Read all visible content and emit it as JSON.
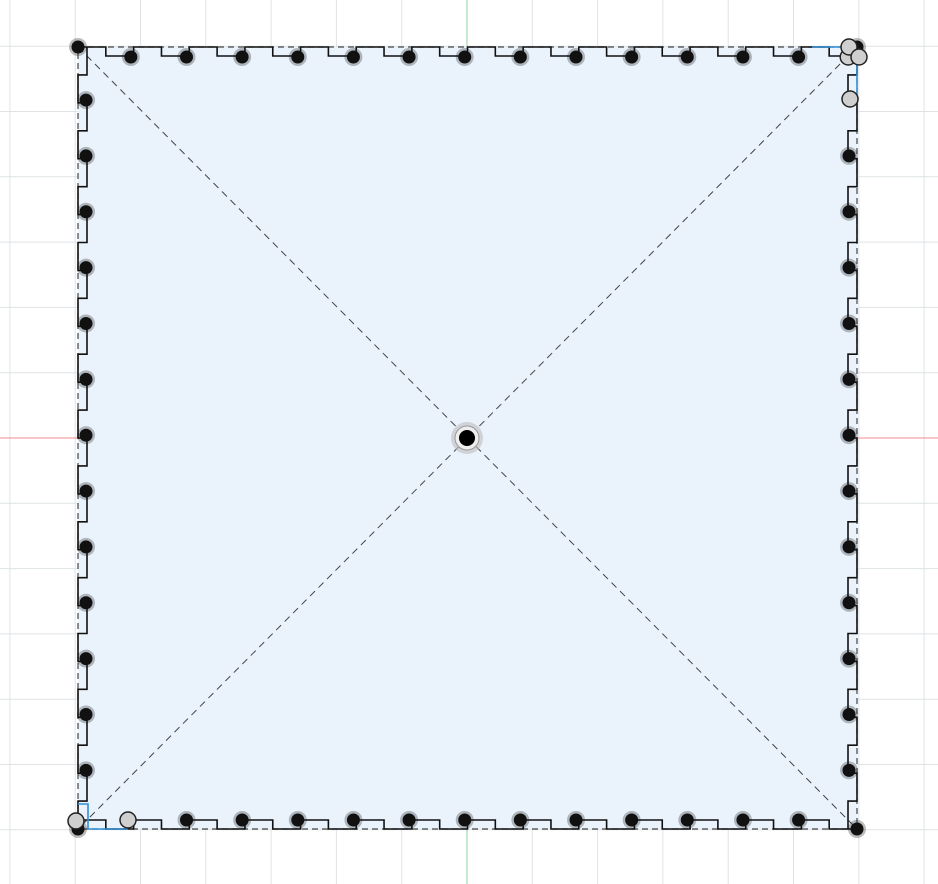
{
  "canvas": {
    "name": "sketch-canvas",
    "background": "#ffffff",
    "grid": {
      "visible": true,
      "major_color": "#dfe3e6",
      "minor_color": "#eef1f3"
    },
    "axes": {
      "x_color": "#f08c8c",
      "y_color": "#8cd6a0"
    },
    "profile_fill": "#eaf3fc",
    "outline_color": "#111111",
    "construction_line_color": "#444444",
    "selection_color": "#2f8fd8"
  },
  "sketch": {
    "shape": "square-with-finger-joints",
    "finger_count_per_side": 14,
    "center_point": {
      "icon": "origin-point-icon"
    },
    "construction_diagonals": 2
  }
}
